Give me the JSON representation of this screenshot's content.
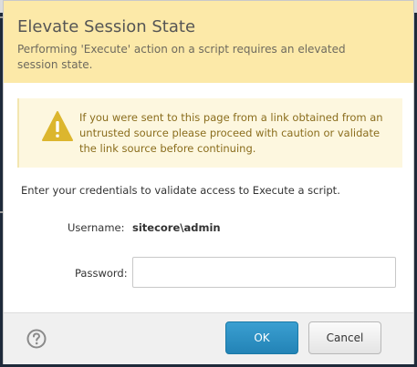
{
  "dialog": {
    "title": "Elevate Session State",
    "subtitle": "Performing 'Execute' action on a script requires an elevated session state."
  },
  "warning": {
    "icon": "warning-triangle-icon",
    "text": "If you were sent to this page from a link obtained from an untrusted source please proceed with caution or validate the link source before continuing."
  },
  "form": {
    "intro": "Enter your credentials to validate access to Execute a script.",
    "username_label": "Username:",
    "username_value": "sitecore\\admin",
    "password_label": "Password:",
    "password_value": "",
    "password_placeholder": ""
  },
  "footer": {
    "help_icon": "question-circle-icon",
    "ok_label": "OK",
    "cancel_label": "Cancel"
  },
  "colors": {
    "header_bg": "#fce9a8",
    "warning_bg": "#fdf7df",
    "warning_icon": "#dcb62e",
    "primary_button": "#2a8cc0",
    "footer_bg": "#f0f0f0"
  }
}
